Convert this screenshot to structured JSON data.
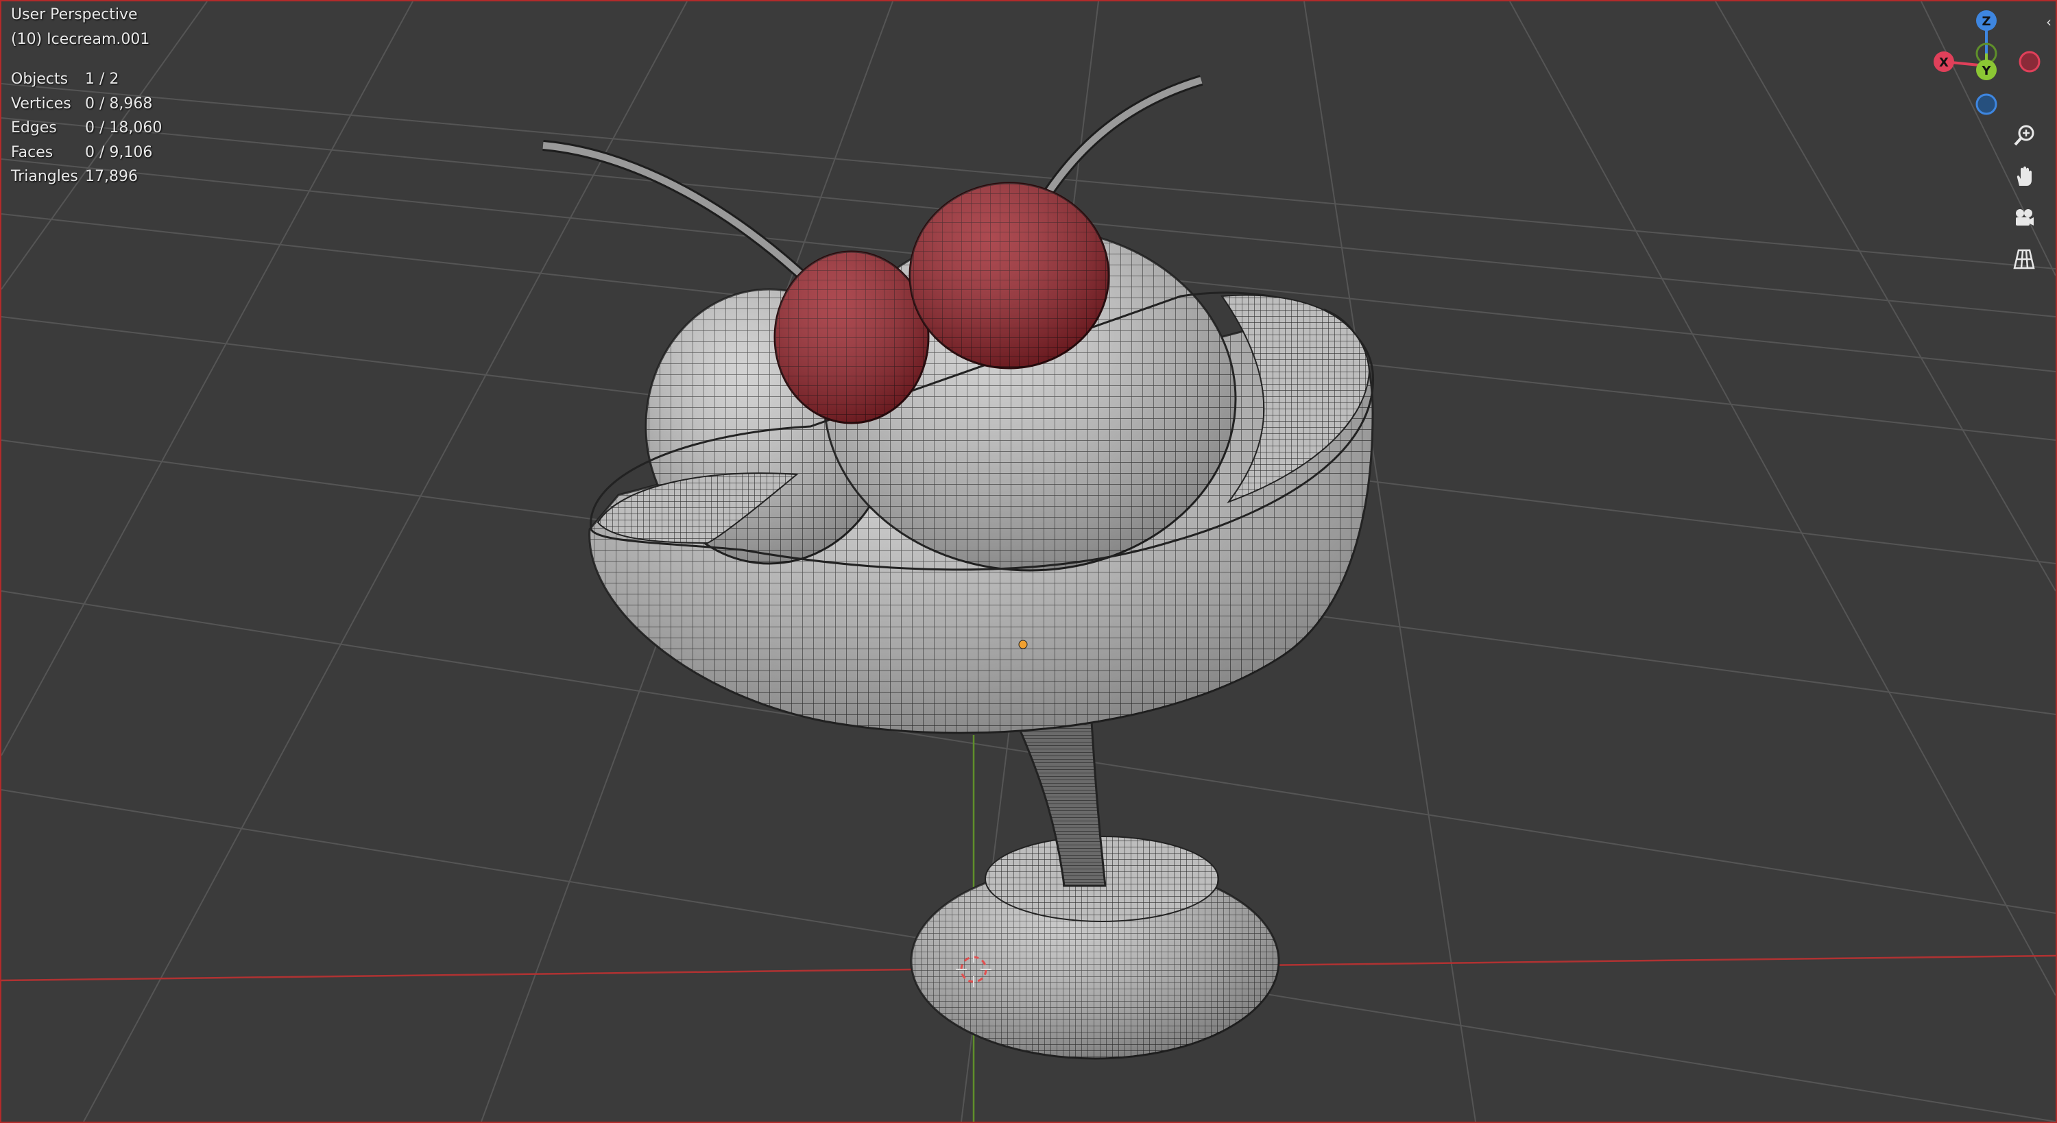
{
  "viewport": {
    "title": "User Perspective",
    "object_label": "(10) Icecream.001"
  },
  "stats": [
    {
      "label": "Objects",
      "value": "1 / 2"
    },
    {
      "label": "Vertices",
      "value": "0 / 8,968"
    },
    {
      "label": "Edges",
      "value": "0 / 18,060"
    },
    {
      "label": "Faces",
      "value": "0 / 9,106"
    },
    {
      "label": "Triangles",
      "value": "17,896"
    }
  ],
  "gizmo": {
    "x_label": "X",
    "y_label": "Y",
    "z_label": "Z",
    "x_color": "#e0405a",
    "y_color": "#8bc734",
    "z_color": "#3e86e0"
  },
  "nav_buttons": [
    {
      "name": "zoom-icon"
    },
    {
      "name": "pan-hand-icon"
    },
    {
      "name": "camera-view-icon"
    },
    {
      "name": "ortho-grid-icon"
    }
  ],
  "colors": {
    "background": "#3b3b3b",
    "grid": "#555555",
    "x_axis_line": "#b03232",
    "y_axis_line": "#5f8f2a",
    "mesh": "#cfcfcf",
    "cherry": "#8e1f24",
    "frame": "#b32a2a"
  }
}
